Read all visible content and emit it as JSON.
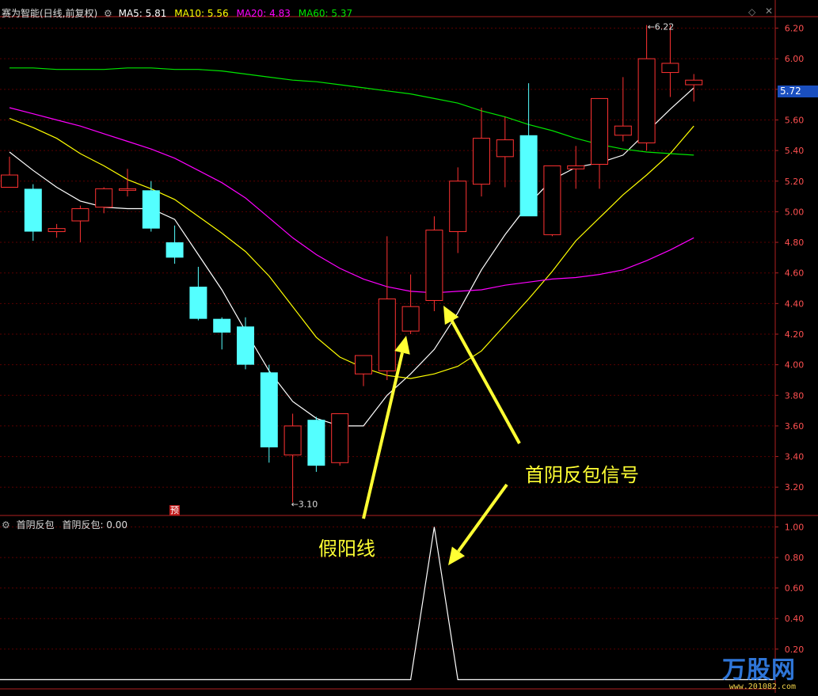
{
  "header": {
    "title": "赛为智能(日线,前复权)",
    "ma5": "MA5: 5.81",
    "ma10": "MA10: 5.56",
    "ma20": "MA20: 4.83",
    "ma60": "MA60: 5.37"
  },
  "indicator": {
    "title": "首阴反包",
    "value_label": "首阴反包: 0.00"
  },
  "annotations": {
    "fake_yang": "假阳线",
    "signal": "首阴反包信号",
    "badge": "预"
  },
  "price_tag": "5.72",
  "logo": {
    "text": "万股网",
    "url": "www.201082.com"
  },
  "colors": {
    "background": "#000000",
    "up": "#ff3232",
    "down": "#54ffff",
    "ma5": "#ffffff",
    "ma10": "#ffff00",
    "ma20": "#ff00ff",
    "ma60": "#00e600",
    "grid": "#5a0000",
    "axis_text": "#ff5050",
    "annotation": "#ffff33"
  },
  "chart_data": [
    {
      "type": "candlestick",
      "title": "赛为智能(日线,前复权)",
      "ylim": [
        3.02,
        6.27
      ],
      "y_ticks": [
        "3.20",
        "3.40",
        "3.60",
        "3.80",
        "4.00",
        "4.20",
        "4.40",
        "4.60",
        "4.80",
        "5.00",
        "5.20",
        "5.40",
        "5.60",
        "5.80",
        "6.00",
        "6.20"
      ],
      "candles": [
        {
          "o": 5.16,
          "h": 5.36,
          "l": 5.16,
          "c": 5.24
        },
        {
          "o": 5.15,
          "h": 5.18,
          "l": 4.81,
          "c": 4.87
        },
        {
          "o": 4.87,
          "h": 4.92,
          "l": 4.83,
          "c": 4.89
        },
        {
          "o": 4.94,
          "h": 5.04,
          "l": 4.8,
          "c": 5.02
        },
        {
          "o": 5.03,
          "h": 5.16,
          "l": 4.99,
          "c": 5.15
        },
        {
          "o": 5.14,
          "h": 5.28,
          "l": 5.1,
          "c": 5.15
        },
        {
          "o": 5.14,
          "h": 5.2,
          "l": 4.87,
          "c": 4.89
        },
        {
          "o": 4.8,
          "h": 4.91,
          "l": 4.66,
          "c": 4.7
        },
        {
          "o": 4.51,
          "h": 4.64,
          "l": 4.29,
          "c": 4.3
        },
        {
          "o": 4.3,
          "h": 4.31,
          "l": 4.1,
          "c": 4.21
        },
        {
          "o": 4.25,
          "h": 4.31,
          "l": 3.97,
          "c": 4.0
        },
        {
          "o": 3.95,
          "h": 4.0,
          "l": 3.36,
          "c": 3.46
        },
        {
          "o": 3.41,
          "h": 3.68,
          "l": 3.1,
          "c": 3.6
        },
        {
          "o": 3.64,
          "h": 3.66,
          "l": 3.3,
          "c": 3.34
        },
        {
          "o": 3.36,
          "h": 3.68,
          "l": 3.34,
          "c": 3.68
        },
        {
          "o": 3.94,
          "h": 4.05,
          "l": 3.86,
          "c": 4.06
        },
        {
          "o": 3.96,
          "h": 4.84,
          "l": 3.9,
          "c": 4.43
        },
        {
          "o": 4.22,
          "h": 4.59,
          "l": 4.2,
          "c": 4.38
        },
        {
          "o": 4.42,
          "h": 4.97,
          "l": 4.35,
          "c": 4.88
        },
        {
          "o": 4.87,
          "h": 5.29,
          "l": 4.73,
          "c": 5.2
        },
        {
          "o": 5.18,
          "h": 5.68,
          "l": 5.1,
          "c": 5.48
        },
        {
          "o": 5.36,
          "h": 5.62,
          "l": 5.16,
          "c": 5.47
        },
        {
          "o": 5.5,
          "h": 5.84,
          "l": 5.0,
          "c": 4.97
        },
        {
          "o": 4.85,
          "h": 5.3,
          "l": 4.84,
          "c": 5.3
        },
        {
          "o": 5.28,
          "h": 5.43,
          "l": 5.15,
          "c": 5.3
        },
        {
          "o": 5.31,
          "h": 5.74,
          "l": 5.15,
          "c": 5.74
        },
        {
          "o": 5.5,
          "h": 5.88,
          "l": 5.46,
          "c": 5.56
        },
        {
          "o": 5.45,
          "h": 6.22,
          "l": 5.4,
          "c": 6.0
        },
        {
          "o": 5.91,
          "h": 6.22,
          "l": 5.75,
          "c": 5.97
        },
        {
          "o": 5.83,
          "h": 5.9,
          "l": 5.72,
          "c": 5.86
        }
      ],
      "series": [
        {
          "name": "MA5",
          "values": [
            5.39,
            5.27,
            5.16,
            5.07,
            5.03,
            5.02,
            5.02,
            4.95,
            4.72,
            4.49,
            4.22,
            3.96,
            3.76,
            3.65,
            3.6,
            3.6,
            3.8,
            3.94,
            4.1,
            4.34,
            4.62,
            4.85,
            5.05,
            5.21,
            5.29,
            5.32,
            5.37,
            5.52,
            5.67,
            5.81
          ]
        },
        {
          "name": "MA10",
          "values": [
            5.61,
            5.55,
            5.48,
            5.38,
            5.3,
            5.21,
            5.15,
            5.08,
            4.97,
            4.86,
            4.74,
            4.58,
            4.38,
            4.18,
            4.05,
            3.98,
            3.93,
            3.91,
            3.94,
            3.99,
            4.09,
            4.26,
            4.43,
            4.61,
            4.81,
            4.96,
            5.11,
            5.24,
            5.38,
            5.56
          ]
        },
        {
          "name": "MA20",
          "values": [
            5.68,
            5.64,
            5.6,
            5.56,
            5.51,
            5.46,
            5.41,
            5.35,
            5.27,
            5.19,
            5.09,
            4.96,
            4.83,
            4.72,
            4.63,
            4.56,
            4.51,
            4.48,
            4.47,
            4.48,
            4.49,
            4.52,
            4.54,
            4.56,
            4.57,
            4.59,
            4.62,
            4.68,
            4.75,
            4.83
          ]
        },
        {
          "name": "MA60",
          "values": [
            5.94,
            5.94,
            5.93,
            5.93,
            5.93,
            5.94,
            5.94,
            5.93,
            5.93,
            5.92,
            5.9,
            5.88,
            5.86,
            5.85,
            5.83,
            5.81,
            5.79,
            5.77,
            5.74,
            5.71,
            5.66,
            5.62,
            5.57,
            5.53,
            5.48,
            5.44,
            5.41,
            5.39,
            5.38,
            5.37
          ]
        }
      ],
      "markers": [
        "←3.10",
        "←6.22"
      ]
    },
    {
      "type": "line",
      "title": "首阴反包",
      "ylim": [
        -0.05,
        1.07
      ],
      "y_ticks": [
        "0.20",
        "0.40",
        "0.60",
        "0.80",
        "1.00"
      ],
      "series": [
        {
          "name": "首阴反包",
          "values": [
            0,
            0,
            0,
            0,
            0,
            0,
            0,
            0,
            0,
            0,
            0,
            0,
            0,
            0,
            0,
            0,
            0,
            0,
            1,
            0,
            0,
            0,
            0,
            0,
            0,
            0,
            0,
            0,
            0,
            0
          ]
        }
      ]
    }
  ]
}
